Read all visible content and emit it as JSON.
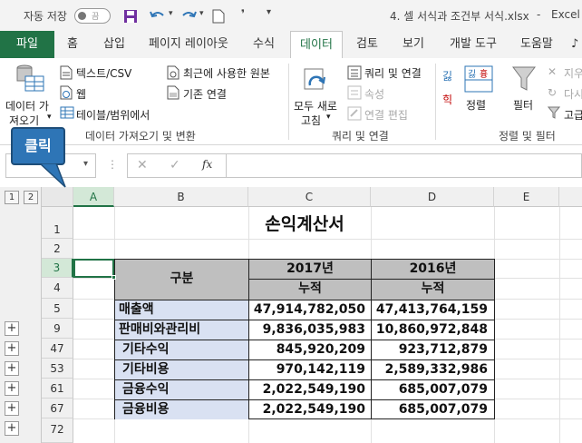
{
  "titlebar": {
    "autosave_label": "자동 저장",
    "autosave_state": "끔",
    "filename": "4. 셀 서식과 조건부 서식.xlsx",
    "app": "Excel"
  },
  "tabs": [
    {
      "label": "파일"
    },
    {
      "label": "홈"
    },
    {
      "label": "삽입"
    },
    {
      "label": "페이지 레이아웃"
    },
    {
      "label": "수식"
    },
    {
      "label": "데이터"
    },
    {
      "label": "검토"
    },
    {
      "label": "보기"
    },
    {
      "label": "개발 도구"
    },
    {
      "label": "도움말"
    }
  ],
  "ribbon": {
    "get_data": {
      "label1": "데이터 가",
      "label2": "져오기"
    },
    "text_csv": "텍스트/CSV",
    "web": "웹",
    "table_range": "테이블/범위에서",
    "recent_sources": "최근에 사용한 원본",
    "existing_conn": "기존 연결",
    "group1": "데이터 가져오기 및 변환",
    "refresh_all": {
      "label1": "모두 새로",
      "label2": "고침"
    },
    "queries_conn": "쿼리 및 연결",
    "properties": "속성",
    "edit_links": "연결 편집",
    "group2": "쿼리 및 연결",
    "sort": "정렬",
    "filter": "필터",
    "clear": "지우",
    "reapply": "다시",
    "advanced": "고급",
    "group3": "정렬 및 필터"
  },
  "callout": "클릭",
  "outline_levels": [
    "1",
    "2"
  ],
  "columns": [
    "A",
    "B",
    "C",
    "D",
    "E"
  ],
  "rows": [
    "1",
    "2",
    "3",
    "4",
    "5",
    "9",
    "47",
    "53",
    "61",
    "67",
    "72"
  ],
  "sheet": {
    "title": "손익계산서",
    "header": {
      "label": "구분",
      "y1": "2017년",
      "y2": "2016년",
      "sub": "누적"
    },
    "data": [
      {
        "label": "매출액",
        "v2017": "47,914,782,050",
        "v2016": "47,413,764,159"
      },
      {
        "label": "판매비와관리비",
        "v2017": "9,836,035,983",
        "v2016": "10,860,972,848"
      },
      {
        "label": " 기타수익",
        "v2017": "845,920,209",
        "v2016": "923,712,879"
      },
      {
        "label": " 기타비용",
        "v2017": "970,142,119",
        "v2016": "2,589,332,986"
      },
      {
        "label": " 금융수익",
        "v2017": "2,022,549,190",
        "v2016": "685,007,079"
      },
      {
        "label": " 금융비용",
        "v2017": "2,022,549,190",
        "v2016": "685,007,079"
      }
    ]
  },
  "colors": {
    "excel_green": "#217346",
    "header_fill": "#bfbfbf",
    "label_fill": "#d9e1f2",
    "callout": "#2e75b6"
  }
}
